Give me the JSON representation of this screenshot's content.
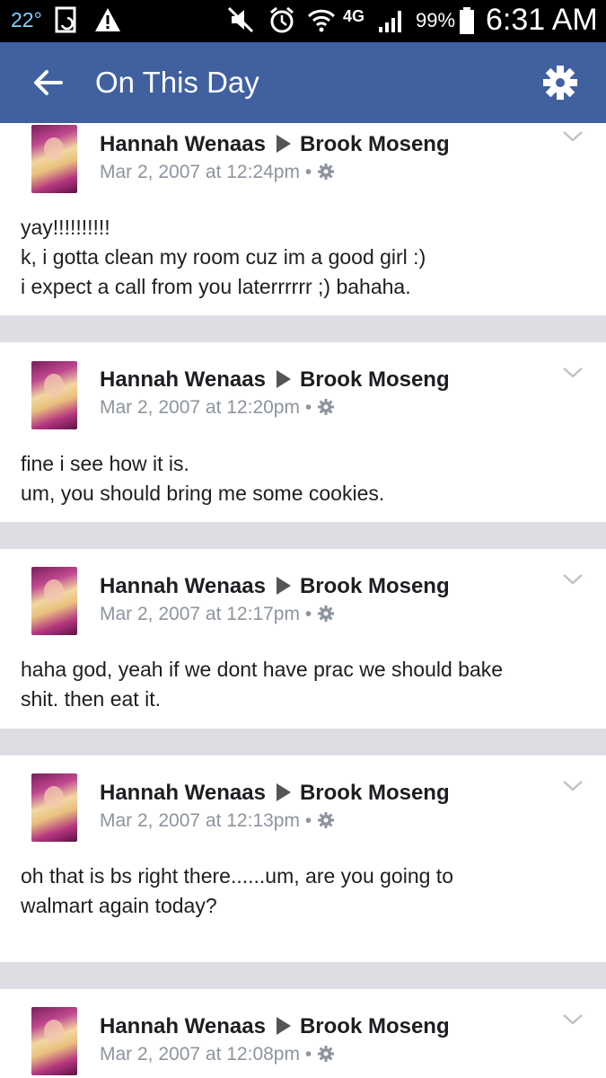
{
  "status_bar": {
    "temperature": "22°",
    "battery": "99%",
    "time": "6:31 AM",
    "network": "4G"
  },
  "header": {
    "title": "On This Day",
    "back_icon": "arrow-left-icon",
    "settings_icon": "gear-icon"
  },
  "posts": [
    {
      "author": "Hannah Wenaas",
      "recipient": "Brook Moseng",
      "timestamp": "Mar 2, 2007 at 12:24pm",
      "lines": [
        "yay!!!!!!!!!!",
        "k, i gotta clean my room cuz im a good girl :)",
        "i expect a call from you laterrrrrr ;) bahaha."
      ]
    },
    {
      "author": "Hannah Wenaas",
      "recipient": "Brook Moseng",
      "timestamp": "Mar 2, 2007 at 12:20pm",
      "lines": [
        "fine i see how it is.",
        "um, you should bring me some cookies."
      ]
    },
    {
      "author": "Hannah Wenaas",
      "recipient": "Brook Moseng",
      "timestamp": "Mar 2, 2007 at 12:17pm",
      "lines": [
        "haha god, yeah if we dont have prac we should bake",
        "shit. then eat it."
      ]
    },
    {
      "author": "Hannah Wenaas",
      "recipient": "Brook Moseng",
      "timestamp": "Mar 2, 2007 at 12:13pm",
      "lines": [
        "oh that is bs right there......um, are you going to",
        "walmart again today?"
      ]
    },
    {
      "author": "Hannah Wenaas",
      "recipient": "Brook Moseng",
      "timestamp": "Mar 2, 2007 at 12:08pm",
      "lines": []
    }
  ]
}
